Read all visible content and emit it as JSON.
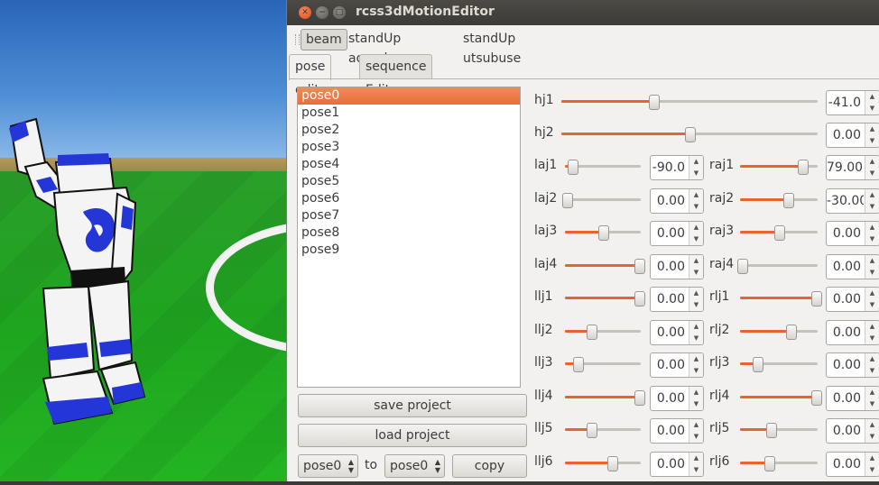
{
  "window": {
    "title": "rcss3dMotionEditor"
  },
  "toolbar": {
    "items": [
      "beam",
      "standUp aomuke",
      "standUp utsubuse"
    ]
  },
  "tabs": [
    "pose edit",
    "sequence Edit"
  ],
  "poses": [
    "pose0",
    "pose1",
    "pose2",
    "pose3",
    "pose4",
    "pose5",
    "pose6",
    "pose7",
    "pose8",
    "pose9"
  ],
  "selected_pose": "pose0",
  "buttons": {
    "save": "save project",
    "load": "load project",
    "copy": "copy"
  },
  "copy_row": {
    "from": "pose0",
    "to_label": "to",
    "to": "pose0"
  },
  "robot": {
    "number": "1"
  },
  "joints": {
    "hj1": {
      "label": "hj1",
      "value": "-41.0",
      "level": 0.36
    },
    "hj2": {
      "label": "hj2",
      "value": "0.00",
      "level": 0.5
    },
    "laj1": {
      "label": "laj1",
      "value": "-90.0",
      "level": 0.1
    },
    "raj1": {
      "label": "raj1",
      "value": "79.00",
      "level": 0.8
    },
    "laj2": {
      "label": "laj2",
      "value": "0.00",
      "level": 0.02
    },
    "raj2": {
      "label": "raj2",
      "value": "-30.00",
      "level": 0.62
    },
    "laj3": {
      "label": "laj3",
      "value": "0.00",
      "level": 0.5
    },
    "raj3": {
      "label": "raj3",
      "value": "0.00",
      "level": 0.5
    },
    "laj4": {
      "label": "laj4",
      "value": "0.00",
      "level": 0.98
    },
    "raj4": {
      "label": "raj4",
      "value": "0.00",
      "level": 0.02
    },
    "llj1": {
      "label": "llj1",
      "value": "0.00",
      "level": 0.98
    },
    "rlj1": {
      "label": "rlj1",
      "value": "0.00",
      "level": 0.98
    },
    "llj2": {
      "label": "llj2",
      "value": "0.00",
      "level": 0.35
    },
    "rlj2": {
      "label": "rlj2",
      "value": "0.00",
      "level": 0.65
    },
    "llj3": {
      "label": "llj3",
      "value": "0.00",
      "level": 0.17
    },
    "rlj3": {
      "label": "rlj3",
      "value": "0.00",
      "level": 0.22
    },
    "llj4": {
      "label": "llj4",
      "value": "0.00",
      "level": 0.98
    },
    "rlj4": {
      "label": "rlj4",
      "value": "0.00",
      "level": 0.98
    },
    "llj5": {
      "label": "llj5",
      "value": "0.00",
      "level": 0.35
    },
    "rlj5": {
      "label": "rlj5",
      "value": "0.00",
      "level": 0.4
    },
    "llj6": {
      "label": "llj6",
      "value": "0.00",
      "level": 0.62
    },
    "rlj6": {
      "label": "rlj6",
      "value": "0.00",
      "level": 0.37
    }
  },
  "colors": {
    "accent": "#e9632e",
    "selection": "#f07746",
    "robot_blue": "#2436d8"
  }
}
